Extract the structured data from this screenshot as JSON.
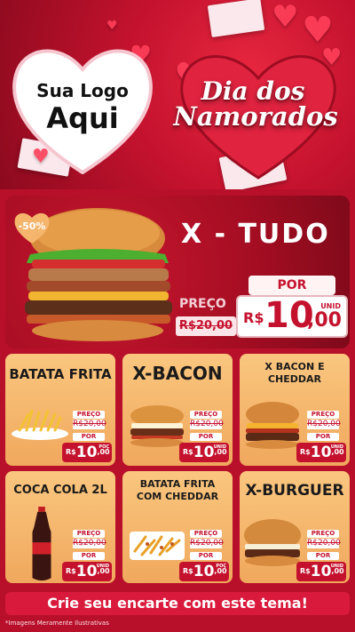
{
  "header": {
    "logo_line1": "Sua Logo",
    "logo_line2": "Aqui",
    "title_line1": "Dia dos",
    "title_line2": "Namorados"
  },
  "hero": {
    "discount": "-50%",
    "title": "X - TUDO",
    "preco_label": "PREÇO",
    "old_price": "R$20,00",
    "por_label": "POR",
    "currency": "R$",
    "price_int": "10",
    "price_dec": ",00",
    "unit": "UNID"
  },
  "products": [
    {
      "name": "BATATA FRITA",
      "preco_label": "PREÇO",
      "old_price": "R$20,00",
      "por_label": "POR",
      "currency": "R$",
      "price_int": "10",
      "price_dec": ",00",
      "unit": "POÇ"
    },
    {
      "name": "X-BACON",
      "preco_label": "PREÇO",
      "old_price": "R$20,00",
      "por_label": "POR",
      "currency": "R$",
      "price_int": "10",
      "price_dec": ",00",
      "unit": "UNID"
    },
    {
      "name_line1": "X BACON E",
      "name_line2": "CHEDDAR",
      "preco_label": "PREÇO",
      "old_price": "R$20,00",
      "por_label": "POR",
      "currency": "R$",
      "price_int": "10",
      "price_dec": ",00",
      "unit": "UNID"
    },
    {
      "name": "COCA COLA 2L",
      "preco_label": "PREÇO",
      "old_price": "R$20,00",
      "por_label": "POR",
      "currency": "R$",
      "price_int": "10",
      "price_dec": ",00",
      "unit": "UNID"
    },
    {
      "name_line1": "BATATA FRITA",
      "name_line2": "COM CHEDDAR",
      "preco_label": "PREÇO",
      "old_price": "R$20,00",
      "por_label": "POR",
      "currency": "R$",
      "price_int": "10",
      "price_dec": ",00",
      "unit": "POÇ"
    },
    {
      "name": "X-BURGUER",
      "preco_label": "PREÇO",
      "old_price": "R$20,00",
      "por_label": "POR",
      "currency": "R$",
      "price_int": "10",
      "price_dec": ",00",
      "unit": "UNID"
    }
  ],
  "footer": {
    "banner": "Crie seu encarte com este tema!",
    "disclaimer": "*Imagens Meramente Ilustrativas"
  },
  "colors": {
    "primary_red": "#c4122e",
    "card_gold": "#f5b56c",
    "white": "#ffffff"
  }
}
